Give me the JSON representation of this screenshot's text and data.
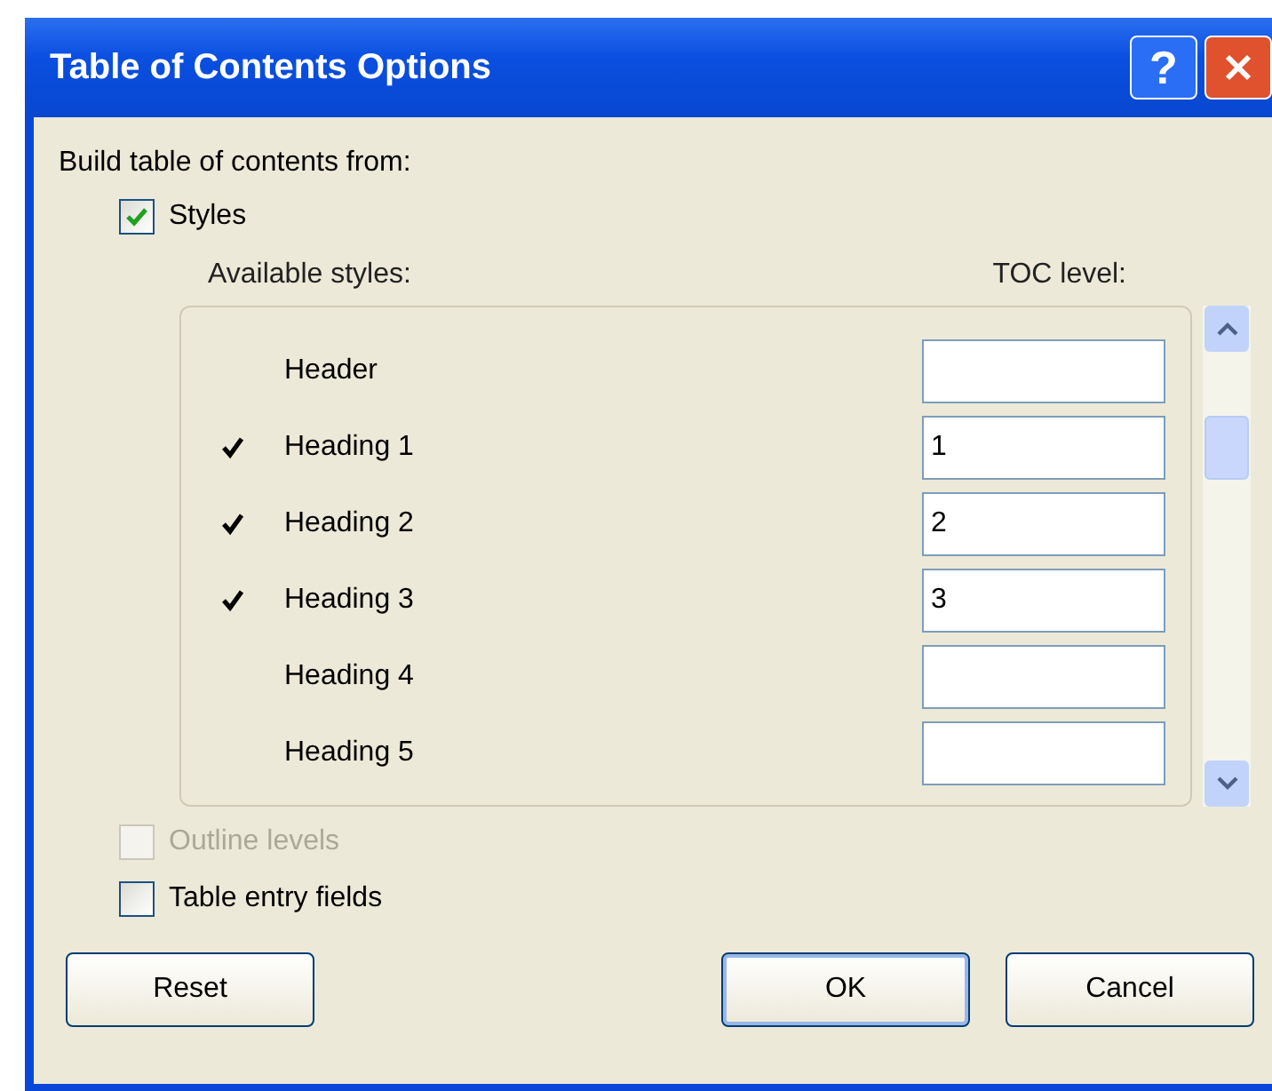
{
  "window": {
    "title": "Table of Contents Options",
    "help": "?"
  },
  "source_label": "Build table of contents from:",
  "options": [
    {
      "label": "Styles",
      "checked": true,
      "disabled": false
    }
  ],
  "columns": [
    "Available styles:",
    "TOC level:"
  ],
  "styles": [
    {
      "name": "Header",
      "included": false
    },
    {
      "name": "Heading 1",
      "included": true,
      "toc_level": "1"
    },
    {
      "name": "Heading 2",
      "included": true,
      "toc_level": "2"
    },
    {
      "name": "Heading 3",
      "included": true,
      "toc_level": "3"
    },
    {
      "name": "Heading 4",
      "included": false
    },
    {
      "name": "Heading 5",
      "included": false
    }
  ],
  "bottom_options": [
    {
      "label": "Outline levels",
      "checked": false,
      "disabled": true
    },
    {
      "label": "Table entry fields",
      "checked": false,
      "disabled": false
    }
  ],
  "buttons": [
    {
      "label": "Reset",
      "default": false
    },
    {
      "label": "OK",
      "default": true
    },
    {
      "label": "Cancel",
      "default": false
    }
  ]
}
